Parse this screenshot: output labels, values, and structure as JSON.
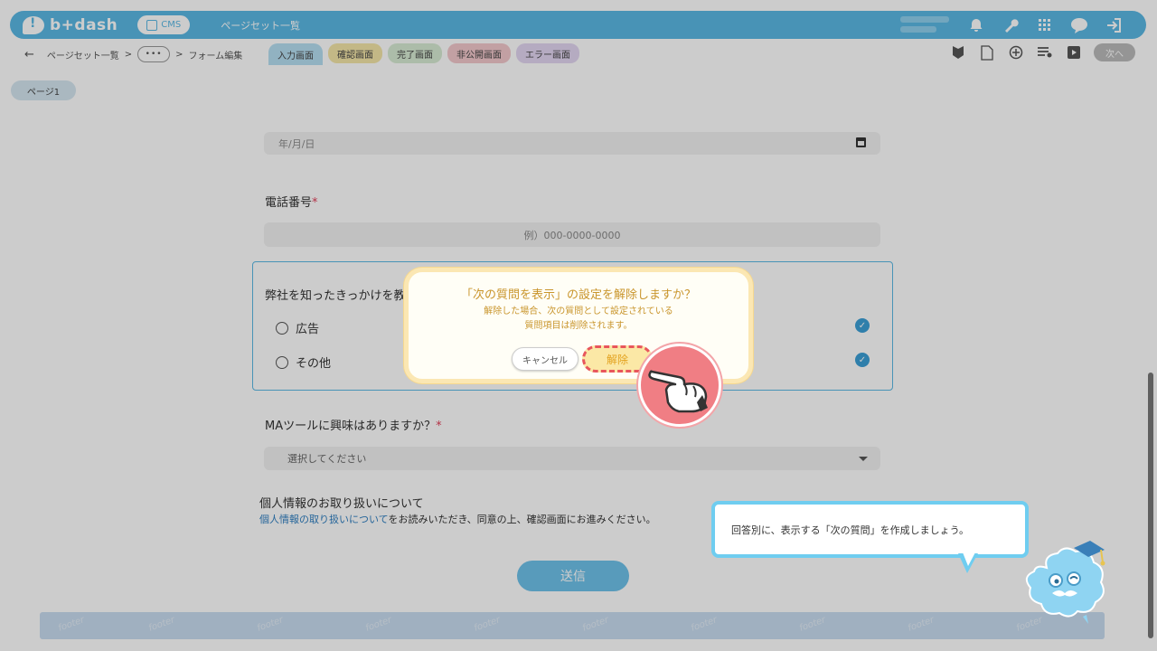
{
  "header": {
    "logo_text": "b+dash",
    "cms_label": "CMS",
    "title": "ページセット一覧"
  },
  "breadcrumb": {
    "back": "←",
    "root": "ページセット一覧",
    "sep": ">",
    "more": "•••",
    "current": "フォーム編集"
  },
  "tabs": [
    "入力画面",
    "確認画面",
    "完了画面",
    "非公開画面",
    "エラー画面"
  ],
  "next_label": "次へ",
  "page_tab": "ページ1",
  "form": {
    "date_placeholder": "年/月/日",
    "phone_label": "電話番号",
    "required_mark": "*",
    "phone_placeholder": "例）000-0000-0000",
    "question_label": "弊社を知ったきっかけを教",
    "options": [
      "広告",
      "その他"
    ],
    "ma_label": "MAツールに興味はありますか？",
    "select_placeholder": "選択してください",
    "privacy_title": "個人情報のお取り扱いについて",
    "privacy_link": "個人情報の取り扱いについて",
    "privacy_rest": "をお読みいただき、同意の上、確認画面にお進みください。",
    "submit_label": "送信"
  },
  "footer_text": "footer",
  "dialog": {
    "title": "「次の質問を表示」の設定を解除しますか？",
    "line1": "解除した場合、次の質問として設定されている",
    "line2": "質問項目は削除されます。",
    "cancel_label": "キャンセル",
    "confirm_label": "解除"
  },
  "tooltip": {
    "text": "回答別に、表示する「次の質問」を作成しましょう。"
  },
  "colors": {
    "brand": "#5bb8e4",
    "accent_red": "#e8565c",
    "dialog_text": "#c9952c"
  }
}
